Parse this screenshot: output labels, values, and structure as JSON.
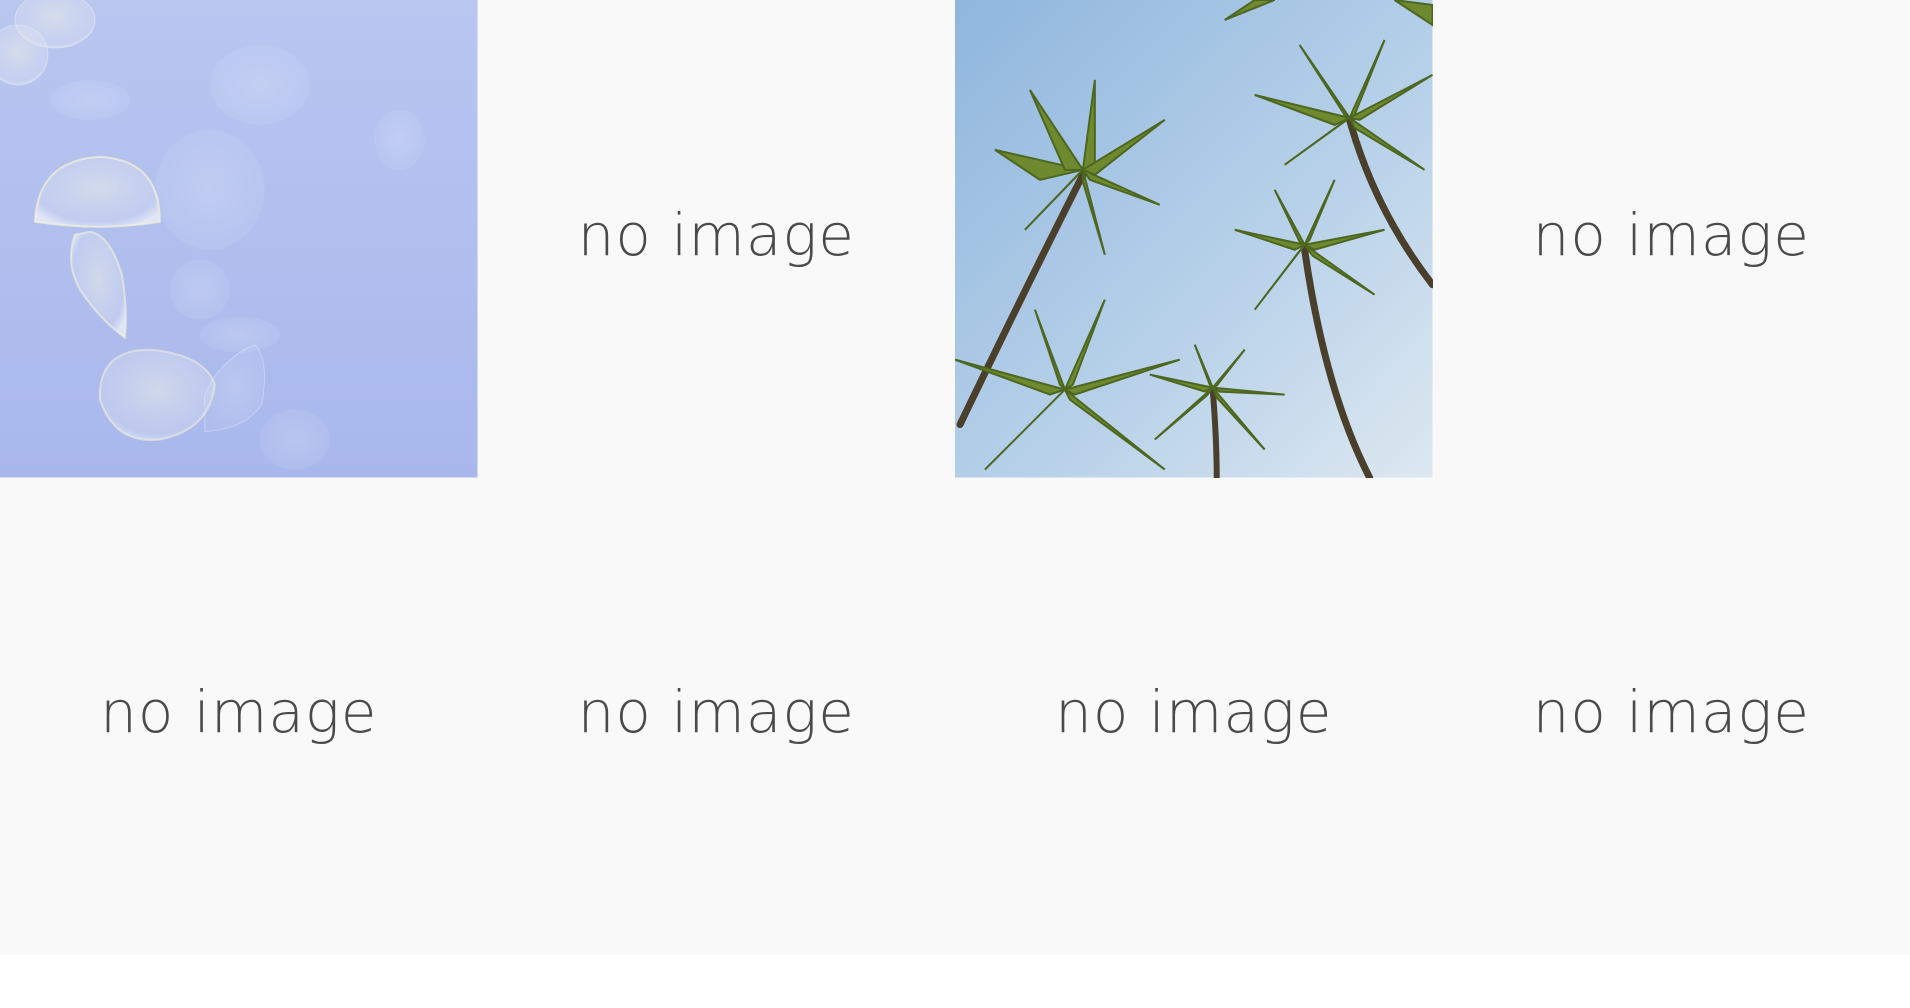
{
  "gallery": {
    "tiles": [
      {
        "kind": "photo",
        "subject": "jellyfish",
        "label": ""
      },
      {
        "kind": "placeholder",
        "label": "no image"
      },
      {
        "kind": "photo",
        "subject": "palm-trees",
        "label": ""
      },
      {
        "kind": "placeholder",
        "label": "no image"
      },
      {
        "kind": "placeholder",
        "label": "no image"
      },
      {
        "kind": "placeholder",
        "label": "no image"
      },
      {
        "kind": "placeholder",
        "label": "no image"
      },
      {
        "kind": "placeholder",
        "label": "no image"
      }
    ]
  },
  "colors": {
    "placeholder_bg": "#f9f9f9",
    "placeholder_text": "#4a4a4a",
    "jellyfish_water": "#b4c2ef",
    "sky": "#9cc0e0"
  }
}
